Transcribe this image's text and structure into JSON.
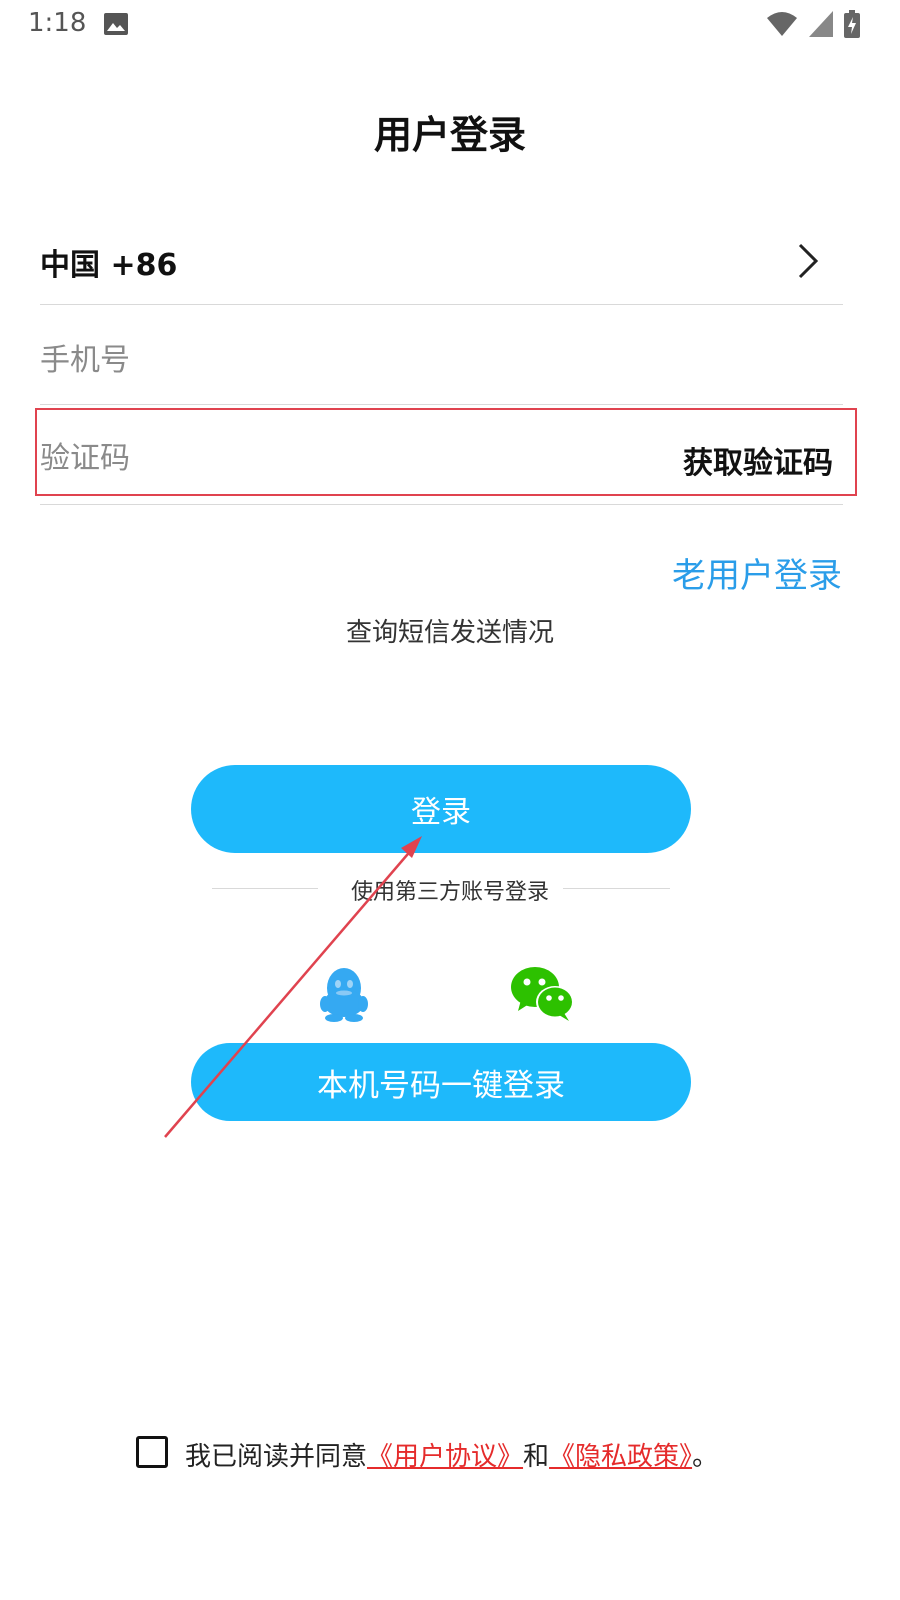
{
  "status_bar": {
    "time": "1:18",
    "icons": [
      "image-icon",
      "wifi-icon",
      "signal-icon",
      "battery-charging-icon"
    ]
  },
  "header": {
    "title": "用户登录"
  },
  "form": {
    "country_code": "中国 +86",
    "phone_placeholder": "手机号",
    "code_placeholder": "验证码",
    "get_code_label": "获取验证码"
  },
  "links": {
    "old_user": "老用户登录",
    "sms_query": "查询短信发送情况"
  },
  "buttons": {
    "login": "登录",
    "onekey": "本机号码一键登录"
  },
  "third_party": {
    "label": "使用第三方账号登录",
    "providers": [
      "qq-icon",
      "wechat-icon"
    ]
  },
  "agreement": {
    "checked": false,
    "prefix": "我已阅读并同意",
    "user_agreement": "《用户协议》",
    "and": "和",
    "privacy_policy": "《隐私政策》",
    "suffix": "。"
  },
  "colors": {
    "primary_button": "#1eb9fb",
    "link_blue": "#2a9de9",
    "link_red": "#e52b2b",
    "annotation_red": "#e0434f",
    "wechat_green": "#2dc100",
    "qq_blue": "#35a9f2"
  }
}
